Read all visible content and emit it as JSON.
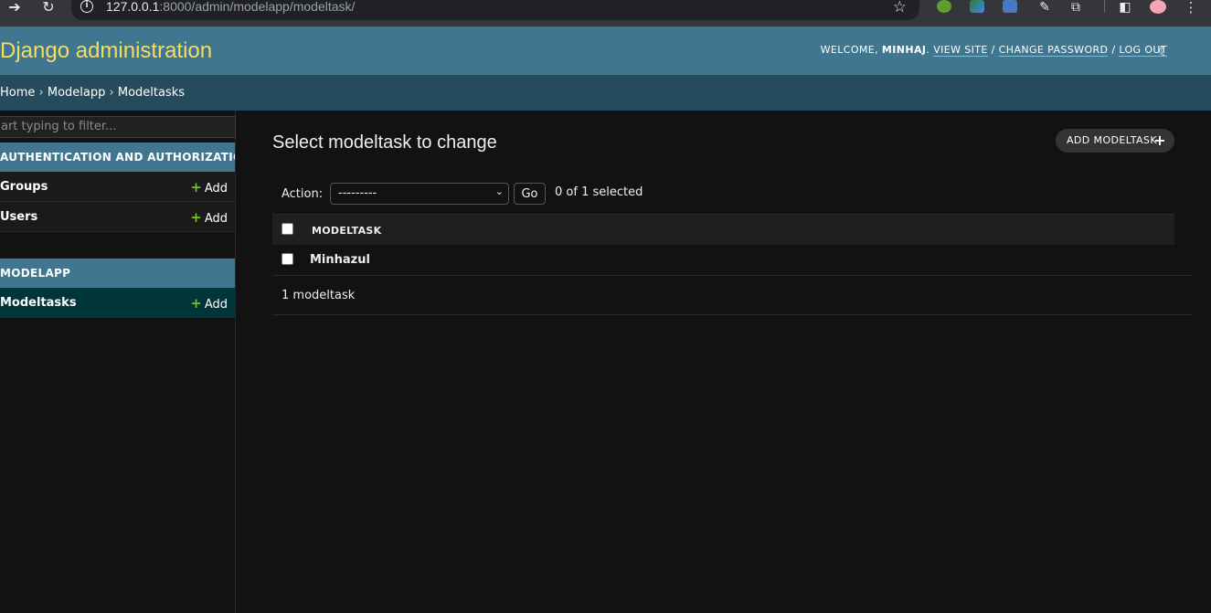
{
  "browser": {
    "url_host": "127.0.0.1",
    "url_path": ":8000/admin/modelapp/modeltask/"
  },
  "header": {
    "branding": "Django administration",
    "welcome": "WELCOME,",
    "username": "MINHAJ",
    "view_site": "VIEW SITE",
    "change_password": "CHANGE PASSWORD",
    "log_out": "LOG OUT"
  },
  "breadcrumbs": {
    "home": "Home",
    "app": "Modelapp",
    "current": "Modeltasks",
    "separator": "›"
  },
  "sidebar": {
    "filter_placeholder": "art typing to filter...",
    "apps": [
      {
        "caption": "AUTHENTICATION AND AUTHORIZATION",
        "models": [
          {
            "name": "Groups",
            "add": "Add"
          },
          {
            "name": "Users",
            "add": "Add"
          }
        ]
      },
      {
        "caption": "MODELAPP",
        "models": [
          {
            "name": "Modeltasks",
            "add": "Add"
          }
        ]
      }
    ]
  },
  "content": {
    "title": "Select modeltask to change",
    "add_button": "ADD MODELTASK",
    "action_label": "Action:",
    "action_value": "---------",
    "go_button": "Go",
    "selected_count": "0 of 1 selected",
    "column_header": "MODELTASK",
    "rows": [
      "Minhazul"
    ],
    "paginator": "1 modeltask"
  },
  "colors": {
    "header_bg": "#417690",
    "branding": "#f5dd5d",
    "breadcrumbs_bg": "#264b5d",
    "current_model_bg": "#00363a",
    "add_plus": "#70bf2b"
  }
}
